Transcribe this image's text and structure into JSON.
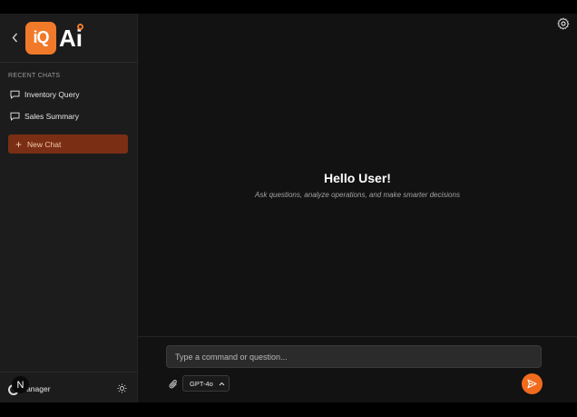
{
  "sidebar": {
    "logo_box_text": "iQ",
    "logo_ai_text": "Ai",
    "recent_label": "RECENT CHATS",
    "items": [
      {
        "label": "Inventory Query",
        "icon": "chat-bubble-icon"
      },
      {
        "label": "Sales Summary",
        "icon": "chat-bubble-icon"
      }
    ],
    "new_chat_label": "New Chat",
    "user": {
      "avatar_letter": "N",
      "name": "Manager"
    },
    "icons": {
      "back": "chevron-left-icon",
      "theme": "sun-icon"
    }
  },
  "main": {
    "title": "Hello User!",
    "subtitle": "Ask questions, analyze operations, and make smarter decisions",
    "icons": {
      "settings": "gear-icon"
    }
  },
  "composer": {
    "placeholder": "Type a command or question...",
    "model": "GPT-4o",
    "icons": {
      "attach": "paperclip-icon",
      "send": "send-icon",
      "model_chevron": "chevron-up-icon"
    }
  },
  "colors": {
    "accent": "#f26b1d",
    "new_chat_bg": "#7a2e14",
    "sidebar_bg": "#1c1c1c",
    "main_bg": "#121212"
  }
}
